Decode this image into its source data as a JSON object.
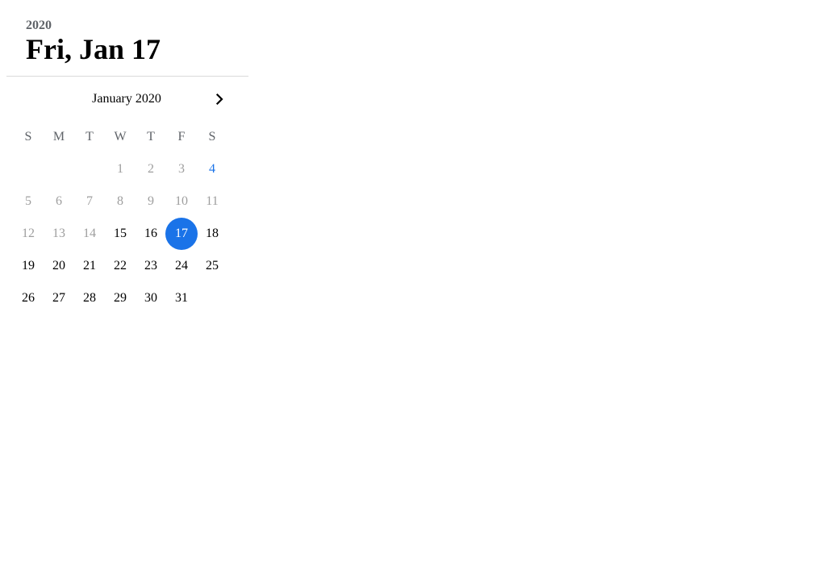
{
  "header": {
    "year": "2020",
    "selected_date": "Fri, Jan 17"
  },
  "calendar": {
    "month_label": "January 2020",
    "next_icon": "chevron-right-icon",
    "weekdays": [
      "S",
      "M",
      "T",
      "W",
      "T",
      "F",
      "S"
    ],
    "weeks": [
      [
        {
          "label": "",
          "state": "empty"
        },
        {
          "label": "",
          "state": "empty"
        },
        {
          "label": "",
          "state": "empty"
        },
        {
          "label": "1",
          "state": "disabled"
        },
        {
          "label": "2",
          "state": "disabled"
        },
        {
          "label": "3",
          "state": "disabled"
        },
        {
          "label": "4",
          "state": "today"
        }
      ],
      [
        {
          "label": "5",
          "state": "disabled"
        },
        {
          "label": "6",
          "state": "disabled"
        },
        {
          "label": "7",
          "state": "disabled"
        },
        {
          "label": "8",
          "state": "disabled"
        },
        {
          "label": "9",
          "state": "disabled"
        },
        {
          "label": "10",
          "state": "disabled"
        },
        {
          "label": "11",
          "state": "disabled"
        }
      ],
      [
        {
          "label": "12",
          "state": "disabled"
        },
        {
          "label": "13",
          "state": "disabled"
        },
        {
          "label": "14",
          "state": "disabled"
        },
        {
          "label": "15",
          "state": "enabled"
        },
        {
          "label": "16",
          "state": "enabled"
        },
        {
          "label": "17",
          "state": "selected"
        },
        {
          "label": "18",
          "state": "enabled"
        }
      ],
      [
        {
          "label": "19",
          "state": "enabled"
        },
        {
          "label": "20",
          "state": "enabled"
        },
        {
          "label": "21",
          "state": "enabled"
        },
        {
          "label": "22",
          "state": "enabled"
        },
        {
          "label": "23",
          "state": "enabled"
        },
        {
          "label": "24",
          "state": "enabled"
        },
        {
          "label": "25",
          "state": "enabled"
        }
      ],
      [
        {
          "label": "26",
          "state": "enabled"
        },
        {
          "label": "27",
          "state": "enabled"
        },
        {
          "label": "28",
          "state": "enabled"
        },
        {
          "label": "29",
          "state": "enabled"
        },
        {
          "label": "30",
          "state": "enabled"
        },
        {
          "label": "31",
          "state": "enabled"
        },
        {
          "label": "",
          "state": "empty"
        }
      ]
    ]
  },
  "colors": {
    "accent": "#1a73e8",
    "disabled_text": "#9e9e9e",
    "weekday_text": "#5f6368"
  }
}
